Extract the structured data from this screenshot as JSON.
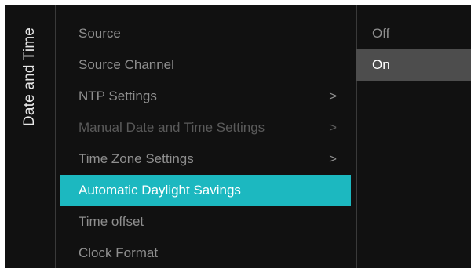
{
  "panel": {
    "title": "Date and Time"
  },
  "menu": {
    "items": [
      {
        "label": "Source",
        "has_submenu": false,
        "state": "normal"
      },
      {
        "label": "Source Channel",
        "has_submenu": false,
        "state": "normal"
      },
      {
        "label": "NTP Settings",
        "has_submenu": true,
        "state": "normal"
      },
      {
        "label": "Manual Date and Time Settings",
        "has_submenu": true,
        "state": "disabled"
      },
      {
        "label": "Time Zone Settings",
        "has_submenu": true,
        "state": "normal"
      },
      {
        "label": "Automatic Daylight Savings",
        "has_submenu": false,
        "state": "selected"
      },
      {
        "label": "Time offset",
        "has_submenu": false,
        "state": "normal"
      },
      {
        "label": "Clock Format",
        "has_submenu": false,
        "state": "normal"
      }
    ],
    "submenu_glyph": ">"
  },
  "options": {
    "items": [
      {
        "label": "Off",
        "current": false
      },
      {
        "label": "On",
        "current": true
      }
    ]
  },
  "colors": {
    "background": "#111111",
    "selection": "#1cb8c0",
    "option_highlight": "#4d4d4d"
  },
  "icons": {
    "submenu": "chevron-right-icon"
  }
}
